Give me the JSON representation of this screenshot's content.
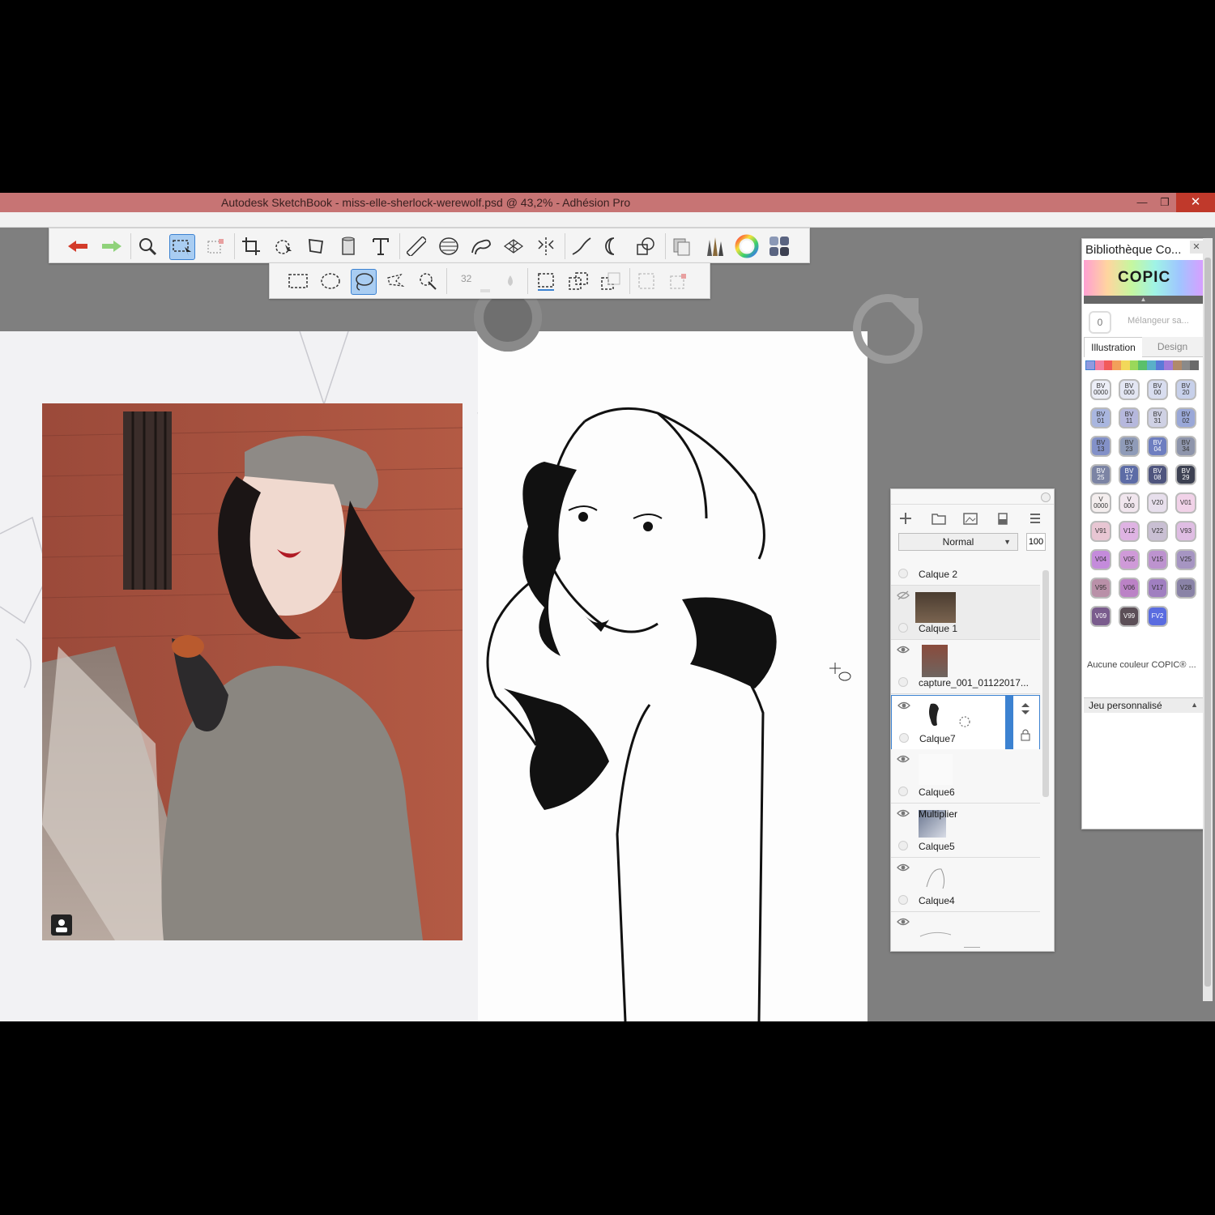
{
  "window": {
    "title": "Autodesk SketchBook - miss-elle-sherlock-werewolf.psd @ 43,2% - Adhésion Pro",
    "minimize_glyph": "—",
    "restore_glyph": "❐",
    "close_glyph": "✕"
  },
  "colors": {
    "titlebar": "#c77474",
    "selection_blue": "#3c82d1",
    "copic_accent": "#1a1a1a"
  },
  "toolbar": {
    "icons": [
      "undo-icon",
      "redo-icon",
      "zoom-icon",
      "selection-icon",
      "transform-selection-icon",
      "crop-icon",
      "move-icon",
      "distort-icon",
      "fill-icon",
      "text-icon",
      "ruler-icon",
      "ellipse-guide-icon",
      "french-curve-icon",
      "perspective-icon",
      "symmetry-icon",
      "stroke-icon",
      "shape-icon",
      "pattern-icon",
      "layers-copy-icon",
      "brushes-icon",
      "color-wheel-icon",
      "copic-icon"
    ],
    "sub_brush_size": "32"
  },
  "layers": {
    "blend_mode": "Normal",
    "opacity": "100",
    "items": [
      {
        "name": "Calque 2",
        "blend": ""
      },
      {
        "name": "Calque 1",
        "blend": ""
      },
      {
        "name": "capture_001_01122017...",
        "blend": ""
      },
      {
        "name": "Calque7",
        "blend": ""
      },
      {
        "name": "Calque6",
        "blend": ""
      },
      {
        "name": "Calque5",
        "blend": "Multiplier"
      },
      {
        "name": "Calque4",
        "blend": ""
      }
    ]
  },
  "copic": {
    "title": "Bibliothèque Co...",
    "logo": "COPIC",
    "mixer_count": "0",
    "mixer_label": "Mélangeur sa...",
    "tabs": [
      "Illustration",
      "Design"
    ],
    "swatches": [
      {
        "top": "BV",
        "bot": "0000",
        "color": "#eceef7"
      },
      {
        "top": "BV",
        "bot": "000",
        "color": "#e3e6f3"
      },
      {
        "top": "BV",
        "bot": "00",
        "color": "#d8ddef"
      },
      {
        "top": "BV",
        "bot": "20",
        "color": "#c7d0ea"
      },
      {
        "top": "BV",
        "bot": "01",
        "color": "#a9b6df"
      },
      {
        "top": "BV",
        "bot": "11",
        "color": "#b6b8dd"
      },
      {
        "top": "BV",
        "bot": "31",
        "color": "#cfd1e4"
      },
      {
        "top": "BV",
        "bot": "02",
        "color": "#9aa8d8"
      },
      {
        "top": "BV",
        "bot": "13",
        "color": "#8391c8"
      },
      {
        "top": "BV",
        "bot": "23",
        "color": "#8f9bb8"
      },
      {
        "top": "BV",
        "bot": "04",
        "color": "#6e7ec0"
      },
      {
        "top": "BV",
        "bot": "34",
        "color": "#8e95ab"
      },
      {
        "top": "BV",
        "bot": "25",
        "color": "#7c84a4"
      },
      {
        "top": "BV",
        "bot": "17",
        "color": "#5d6ca6"
      },
      {
        "top": "BV",
        "bot": "08",
        "color": "#4f557e"
      },
      {
        "top": "BV",
        "bot": "29",
        "color": "#3d4152"
      },
      {
        "top": "V",
        "bot": "0000",
        "color": "#f4eeee"
      },
      {
        "top": "V",
        "bot": "000",
        "color": "#f1e6ee"
      },
      {
        "top": "",
        "bot": "V20",
        "color": "#e7dfec"
      },
      {
        "top": "",
        "bot": "V01",
        "color": "#f1d2e8"
      },
      {
        "top": "",
        "bot": "V91",
        "color": "#e8c6d3"
      },
      {
        "top": "",
        "bot": "V12",
        "color": "#dfb3e3"
      },
      {
        "top": "",
        "bot": "V22",
        "color": "#c9bfd3"
      },
      {
        "top": "",
        "bot": "V93",
        "color": "#dfbde3"
      },
      {
        "top": "",
        "bot": "V04",
        "color": "#c48bdb"
      },
      {
        "top": "",
        "bot": "V05",
        "color": "#cf9ad8"
      },
      {
        "top": "",
        "bot": "V15",
        "color": "#bd93cf"
      },
      {
        "top": "",
        "bot": "V25",
        "color": "#a695c2"
      },
      {
        "top": "",
        "bot": "V95",
        "color": "#b990a8"
      },
      {
        "top": "",
        "bot": "V06",
        "color": "#bb82c6"
      },
      {
        "top": "",
        "bot": "V17",
        "color": "#a07fc0"
      },
      {
        "top": "",
        "bot": "V28",
        "color": "#8a83a7"
      },
      {
        "top": "",
        "bot": "V09",
        "color": "#7a5c8d"
      },
      {
        "top": "",
        "bot": "V99",
        "color": "#5c4f57"
      },
      {
        "top": "",
        "bot": "FV2",
        "color": "#5a6ce0"
      }
    ],
    "no_color": "Aucune couleur COPIC® ...",
    "custom_set": "Jeu personnalisé"
  }
}
